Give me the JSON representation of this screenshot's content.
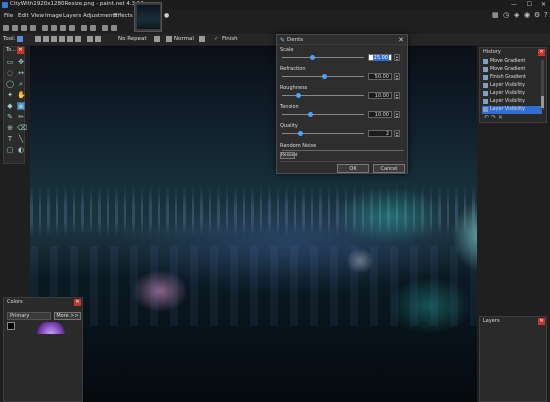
{
  "window": {
    "title": "CityWith1920x1280Resize.png - paint.net 4.3.12"
  },
  "menu": [
    "File",
    "Edit",
    "View",
    "Image",
    "Layers",
    "Adjustments",
    "Effects"
  ],
  "toolbar": {
    "tool_label": "Tool:",
    "repeat": "No Repeat",
    "blend": "Normal",
    "finish": "Finish"
  },
  "tools_panel": {
    "title": "To..."
  },
  "dialog": {
    "title": "Dents",
    "params": [
      {
        "label": "Scale",
        "value": "25.00",
        "level": 0.35
      },
      {
        "label": "Refraction",
        "value": "50.00",
        "level": 0.5
      },
      {
        "label": "Roughness",
        "value": "10.00",
        "level": 0.18
      },
      {
        "label": "Tension",
        "value": "10.00",
        "level": 0.32
      },
      {
        "label": "Quality",
        "value": "2",
        "level": 0.2
      }
    ],
    "random_label": "Random Noise",
    "reseed": "Reseed",
    "ok": "OK",
    "cancel": "Cancel"
  },
  "history": {
    "title": "History",
    "items": [
      "Move Gradient",
      "Move Gradient",
      "Finish Gradient",
      "Layer Visibility",
      "Layer Visibility",
      "Layer Visibility",
      "Layer Visibility"
    ],
    "selected_index": 6
  },
  "colors": {
    "title": "Colors",
    "primary": "Primary",
    "more": "More >>"
  },
  "layers": {
    "title": "Layers"
  },
  "accent": "#2f6fd1"
}
